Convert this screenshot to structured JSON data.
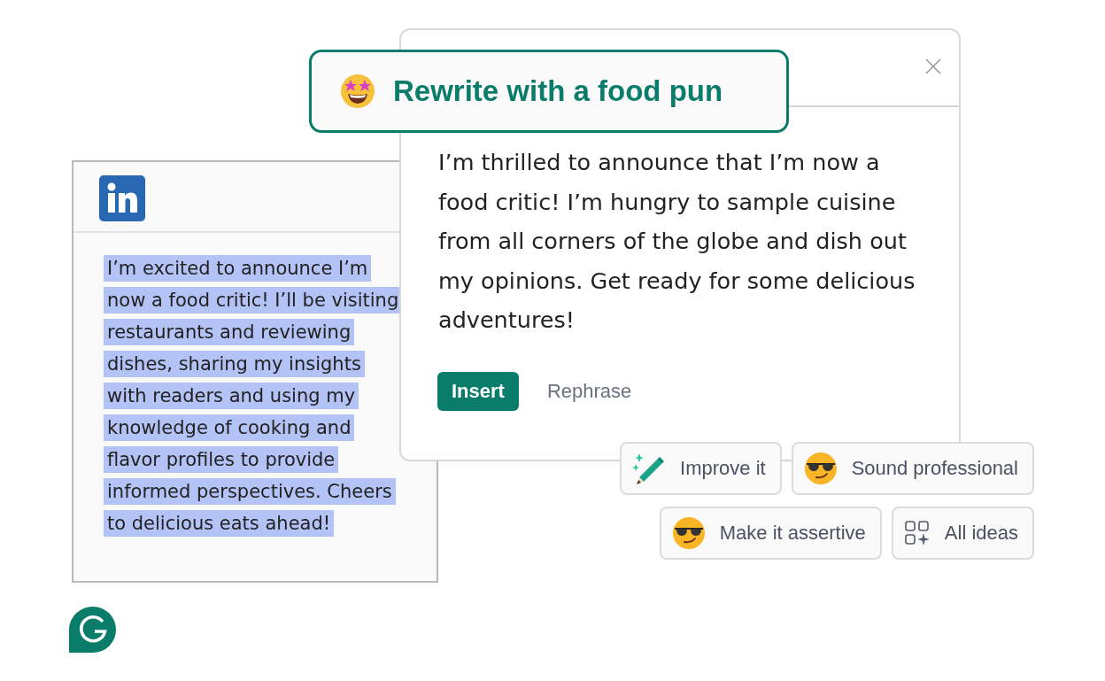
{
  "linkedin_post": {
    "text": "I’m excited to announce I’m now a food critic! I’ll be visiting restaurants and reviewing dishes, sharing my insights with readers and using my knowledge of cooking and flavor profiles to provide informed perspectives. Cheers to delicious eats ahead!",
    "selected": true
  },
  "rewrite_panel": {
    "prompt": "Rewrite with a food pun",
    "result": "I’m thrilled to announce that I’m now a food critic! I’m hungry to sample cuisine from all corners of the globe and dish out my opinions. Get ready for some delicious adventures!",
    "actions": [
      {
        "label": "Insert",
        "kind": "primary"
      },
      {
        "label": "Rephrase",
        "kind": "link"
      }
    ]
  },
  "suggestion_rows": [
    [
      {
        "label": "Improve it",
        "kind": "pencil"
      },
      {
        "label": "Sound professional",
        "kind": "cool"
      }
    ],
    [
      {
        "label": "Make it assertive",
        "kind": "cool"
      },
      {
        "label": "All ideas",
        "kind": "grid"
      }
    ]
  ]
}
